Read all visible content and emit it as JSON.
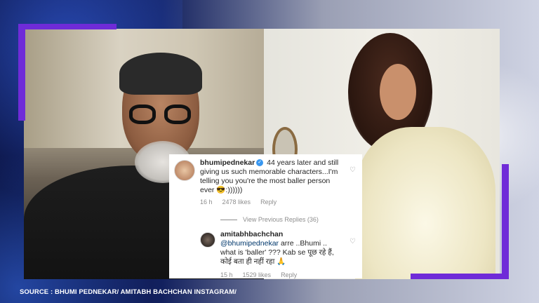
{
  "comment_1": {
    "username": "bhumipednekar",
    "verified": true,
    "text": "44 years later and still giving us such memorable characters...I'm telling you you're the most baller person ever 😎:))))))",
    "time": "16 h",
    "likes": "2478 likes",
    "reply": "Reply"
  },
  "view_previous_replies": "View Previous Replies (36)",
  "comment_2": {
    "username": "amitabhbachchan",
    "mention": "@bhumipednekar",
    "text": "arre ..Bhumi .. what is 'baller' ??? Kab se पूछ रहे हैं, कोई बता ही नहीं रहा 🙏",
    "time": "15 h",
    "likes": "1529 likes",
    "reply": "Reply"
  },
  "source_caption": "SOURCE : BHUMI PEDNEKAR/ AMITABH BACHCHAN  INSTAGRAM/",
  "colors": {
    "accent": "#6f2bd8",
    "verified_badge": "#3897f0",
    "meta_gray": "#8e8e8e",
    "mention_blue": "#00376b"
  },
  "icons": [
    "verified-badge-icon",
    "heart-icon"
  ]
}
